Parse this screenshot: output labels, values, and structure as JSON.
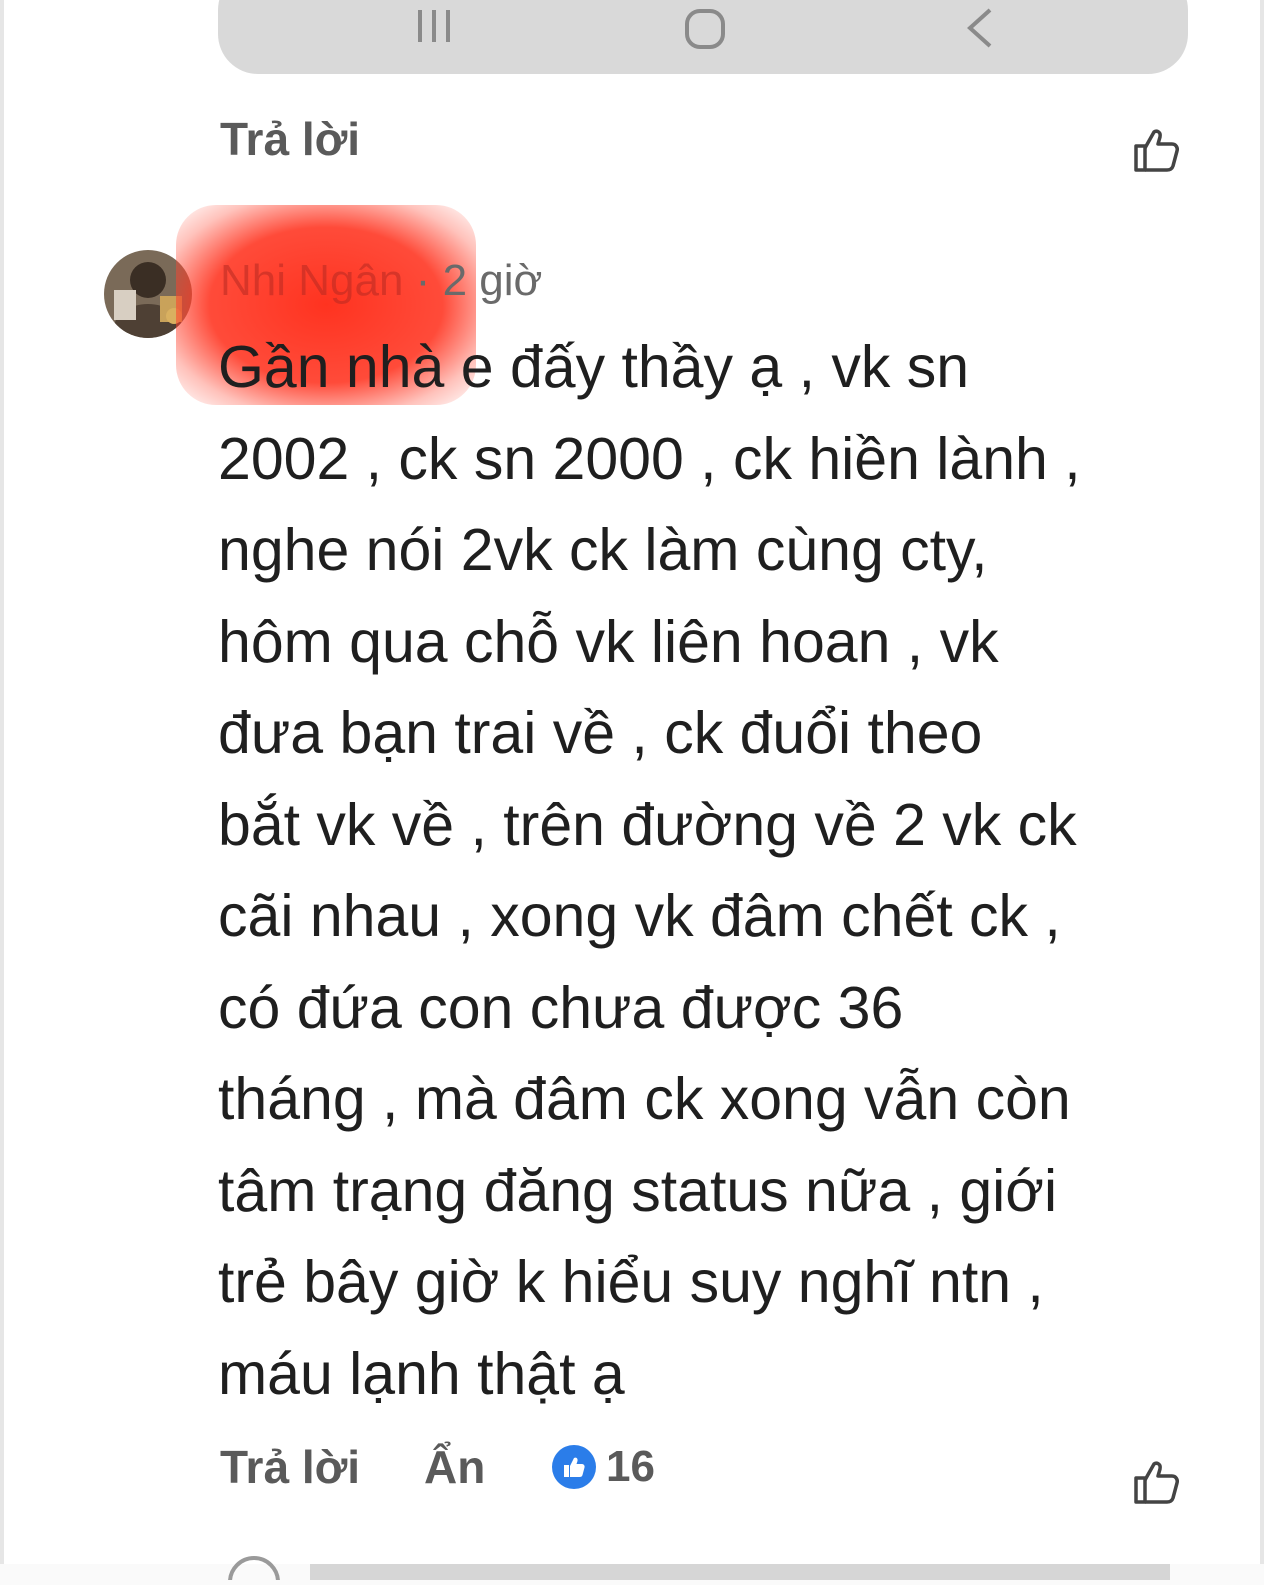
{
  "top_reply": {
    "reply_label": "Trả lời",
    "like_icon": "thumbs-up-outline-icon"
  },
  "comment": {
    "author": "Nhi Ngân",
    "separator": "·",
    "timestamp": "2 giờ",
    "lines": [
      "Gần nhà e đấy thầy ạ , vk sn",
      "2002 , ck sn 2000 , ck hiền lành ,",
      "nghe nói 2vk ck làm cùng cty,",
      "hôm qua chỗ vk liên hoan , vk",
      "đưa bạn trai về , ck đuổi theo",
      "bắt vk về , trên đường về 2 vk ck",
      "cãi nhau , xong vk đâm chết ck ,",
      "có đứa con chưa được 36",
      "tháng , mà đâm ck xong vẫn còn",
      "tâm trạng đăng status nữa , giới",
      "trẻ bây giờ k hiểu suy nghĩ ntn ,",
      "máu lạnh thật ạ"
    ],
    "actions": {
      "reply_label": "Trả lời",
      "hide_label": "Ẩn",
      "reaction_icon": "like-reaction-icon",
      "reaction_count": "16"
    }
  },
  "colors": {
    "accent": "#2b7de9",
    "redaction": "#ff2a14",
    "text": "#1f1f1f",
    "muted": "#5a5a5a"
  }
}
